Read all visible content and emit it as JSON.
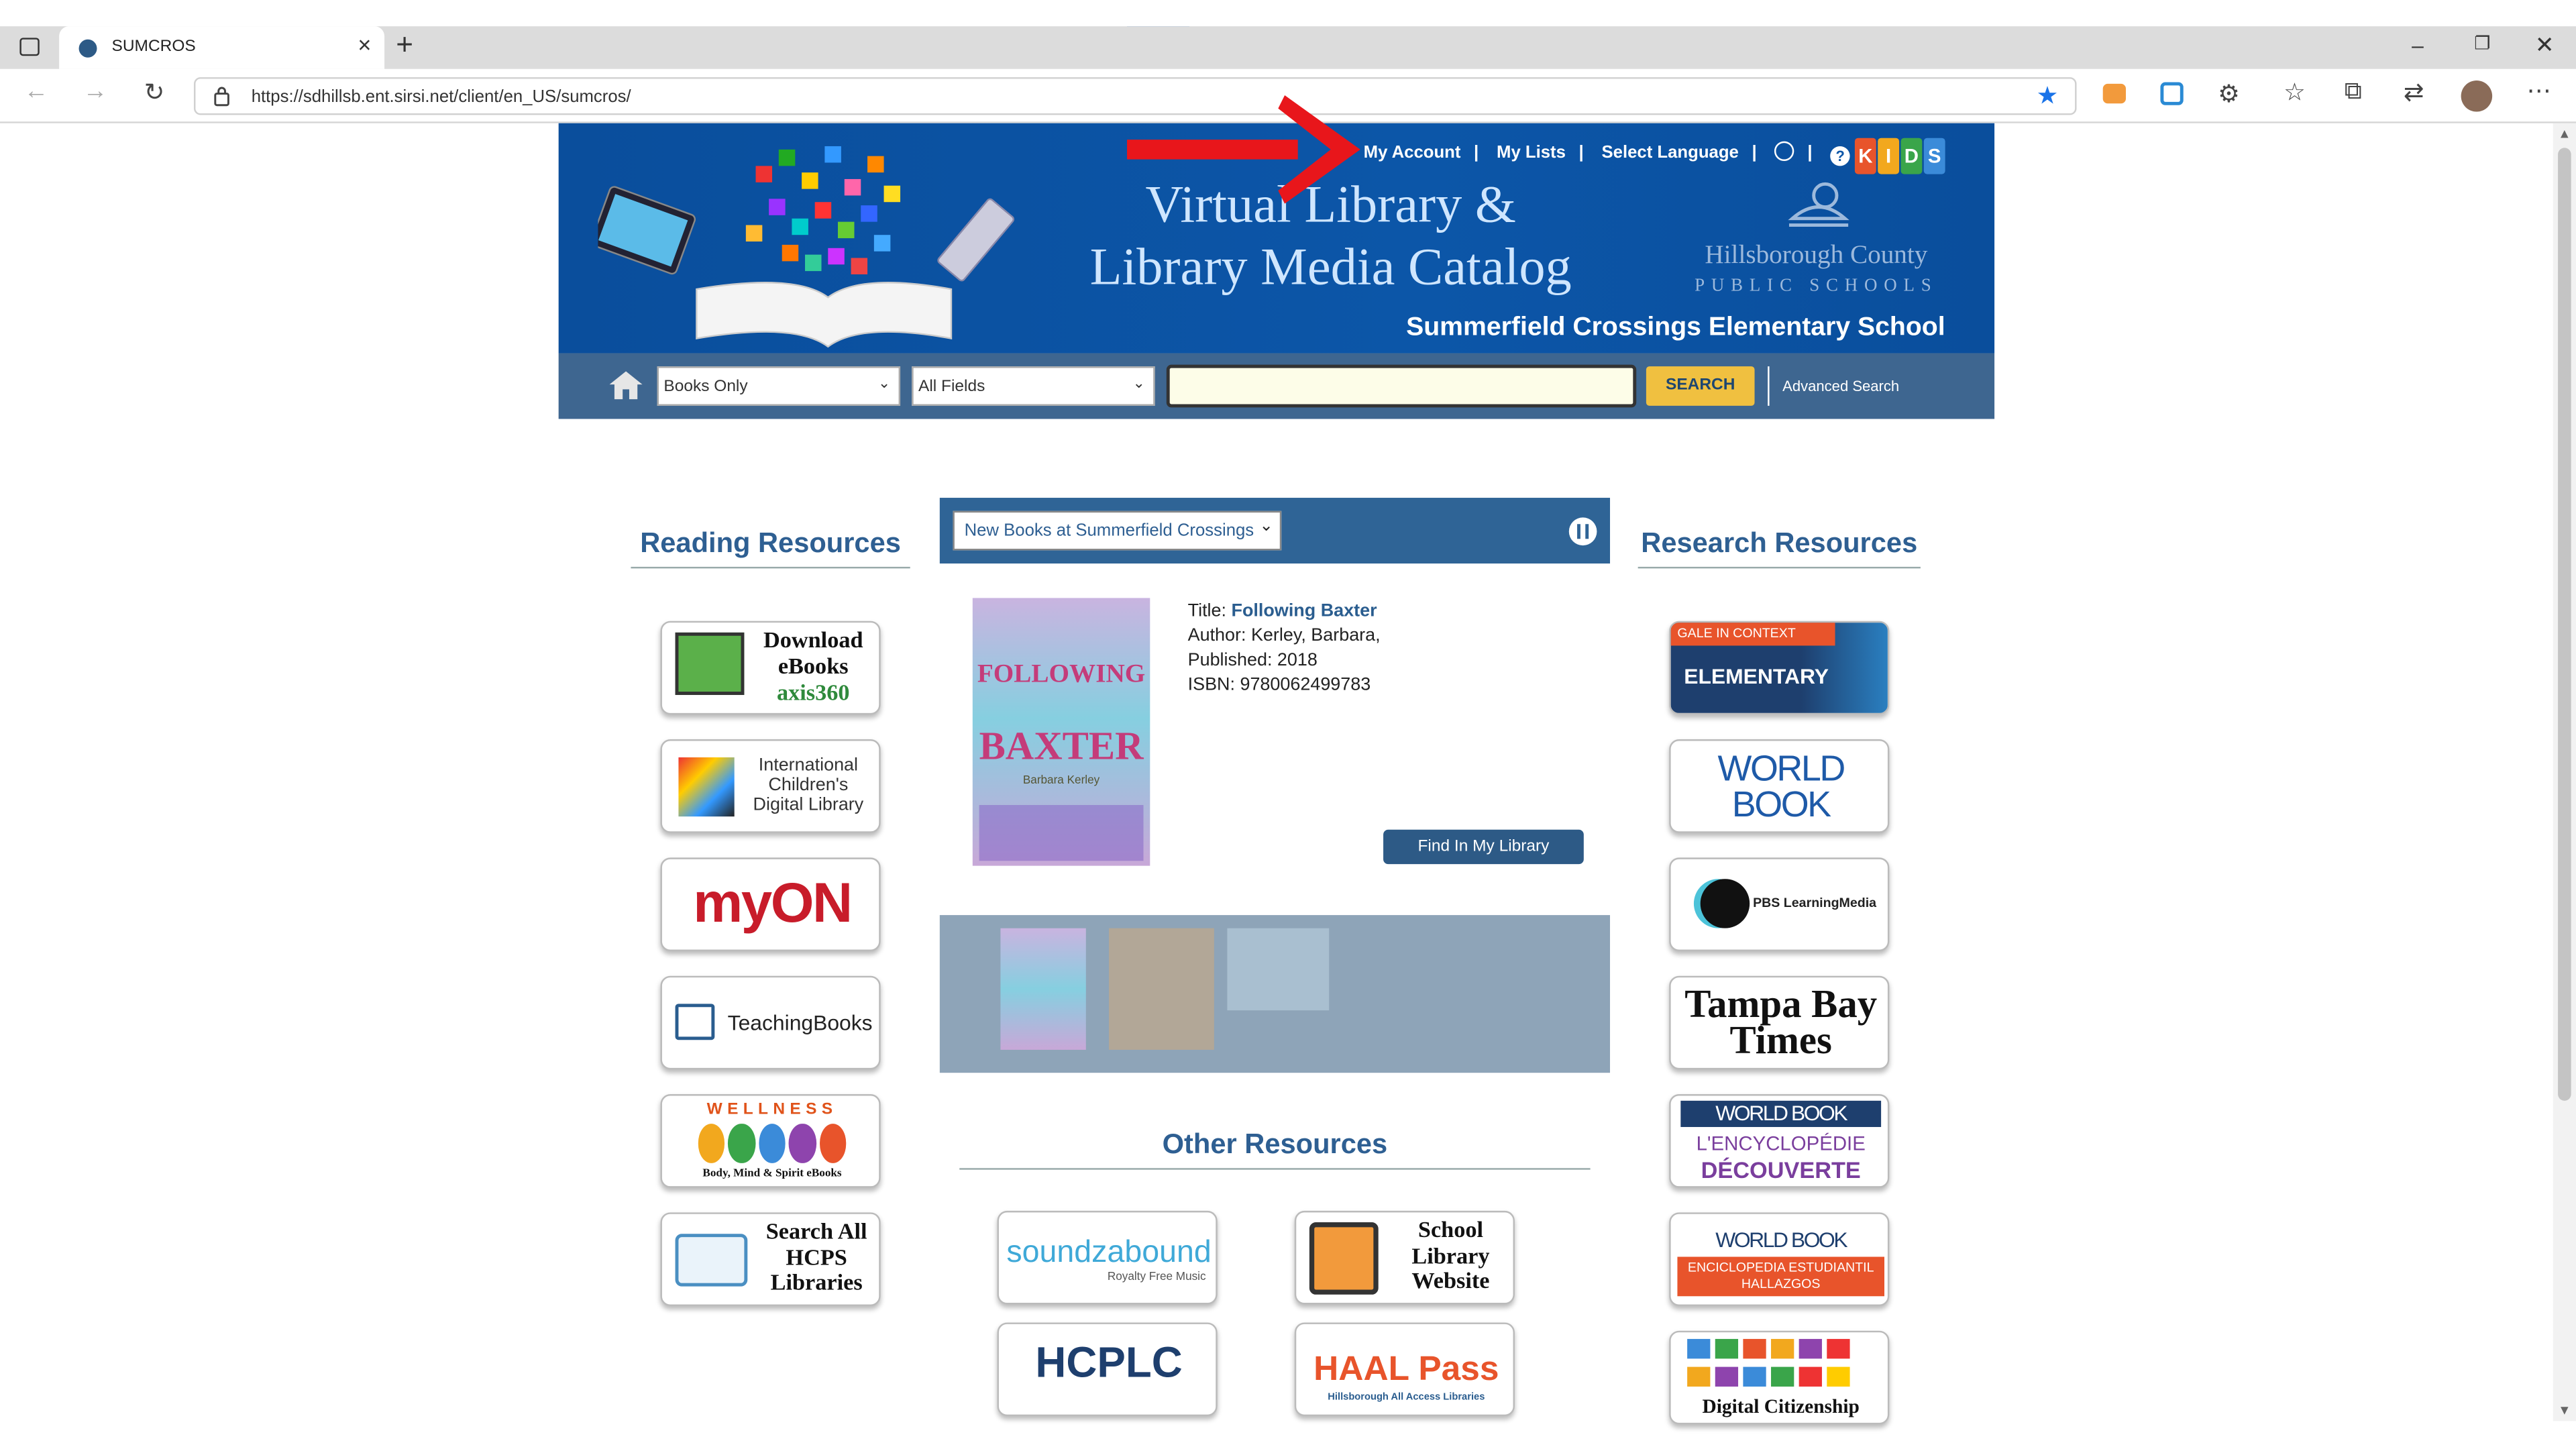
{
  "browser": {
    "tab_title": "SUMCROS",
    "url": "https://sdhillsb.ent.sirsi.net/client/en_US/sumcros/"
  },
  "header": {
    "links": [
      "My Account",
      "My Lists",
      "Select Language"
    ],
    "title_line1": "Virtual Library &",
    "title_line2": "Library Media Catalog",
    "school": "Summerfield Crossings Elementary School",
    "district_line1": "Hillsborough County",
    "district_line2": "PUBLIC SCHOOLS",
    "kids_letters": [
      "K",
      "I",
      "D",
      "S"
    ]
  },
  "search": {
    "type_value": "Books Only",
    "field_value": "All Fields",
    "query": "",
    "button": "SEARCH",
    "advanced": "Advanced Search"
  },
  "reading": {
    "heading": "Reading Resources",
    "items": [
      "Download eBooks",
      "axis360",
      "International Children's Digital Library",
      "myON",
      "TeachingBooks",
      "WELLNESS",
      "Body, Mind & Spirit eBooks",
      "Search All HCPS Libraries"
    ]
  },
  "carousel": {
    "select_value": "New Books at Summerfield Crossings",
    "title_label": "Title:",
    "title": "Following Baxter",
    "author": "Author: Kerley, Barbara,",
    "published": "Published: 2018",
    "isbn": "ISBN: 9780062499783",
    "find_button": "Find In My Library",
    "cover_text_1": "FOLLOWING",
    "cover_text_2": "BAXTER",
    "cover_author": "Barbara Kerley"
  },
  "research": {
    "heading": "Research Resources",
    "items": [
      "GALE IN CONTEXT",
      "ELEMENTARY",
      "WORLD BOOK",
      "PBS LearningMedia",
      "Tampa Bay Times",
      "WORLD BOOK",
      "L'ENCYCLOPÉDIE",
      "DÉCOUVERTE",
      "WORLD BOOK",
      "ENCICLOPEDIA ESTUDIANTIL HALLAZGOS",
      "Digital Citizenship"
    ]
  },
  "other": {
    "heading": "Other Resources",
    "items": [
      "soundzabound",
      "Royalty Free Music",
      "School Library Website",
      "HCPLC",
      "HAAL Pass",
      "Hillsborough All Access Libraries"
    ]
  },
  "colors": {
    "banner": "#0c56a8",
    "searchbar": "#3e6690",
    "heading": "#2e5f92",
    "search_button": "#f0c040",
    "arrow": "#e8161b"
  }
}
